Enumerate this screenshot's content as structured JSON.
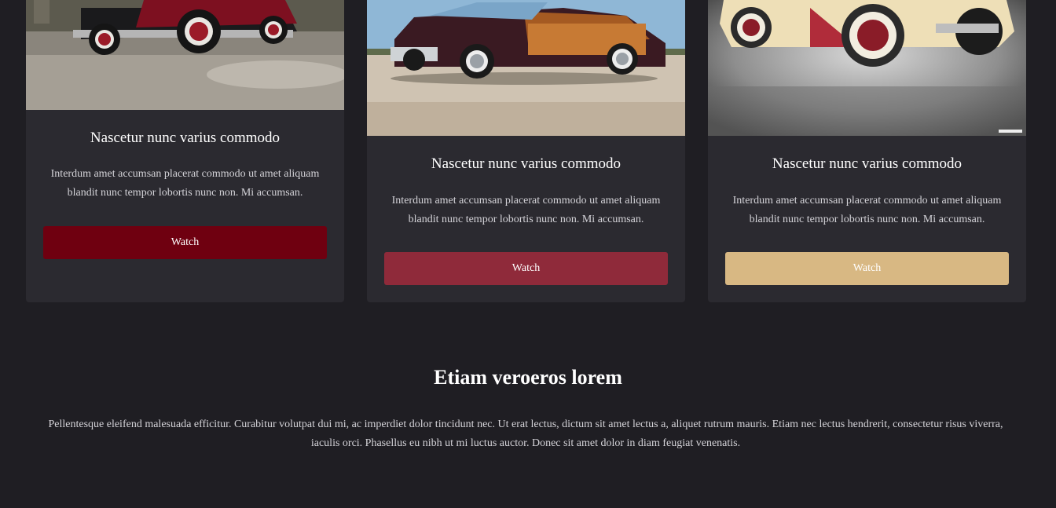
{
  "cards": [
    {
      "title": "Nascetur nunc varius commodo",
      "description": "Interdum amet accumsan placerat commodo ut amet aliquam blandit nunc tempor lobortis nunc non. Mi accumsan.",
      "button_label": "Watch",
      "button_color": "#6f0010",
      "image": "vintage-red-black-car-photo"
    },
    {
      "title": "Nascetur nunc varius commodo",
      "description": "Interdum amet accumsan placerat commodo ut amet aliquam blandit nunc tempor lobortis nunc non. Mi accumsan.",
      "button_label": "Watch",
      "button_color": "#8f2a3a",
      "image": "woody-wagon-maroon-car-photo"
    },
    {
      "title": "Nascetur nunc varius commodo",
      "description": "Interdum amet accumsan placerat commodo ut amet aliquam blandit nunc tempor lobortis nunc non. Mi accumsan.",
      "button_label": "Watch",
      "button_color": "#d8b883",
      "image": "cream-classic-roadster-photo"
    }
  ],
  "section": {
    "title": "Etiam veroeros lorem",
    "text": "Pellentesque eleifend malesuada efficitur. Curabitur volutpat dui mi, ac imperdiet dolor tincidunt nec. Ut erat lectus, dictum sit amet lectus a, aliquet rutrum mauris. Etiam nec lectus hendrerit, consectetur risus viverra, iaculis orci. Phasellus eu nibh ut mi luctus auctor. Donec sit amet dolor in diam feugiat venenatis."
  },
  "colors": {
    "background": "#1f1e23",
    "card": "#2b2a30"
  }
}
